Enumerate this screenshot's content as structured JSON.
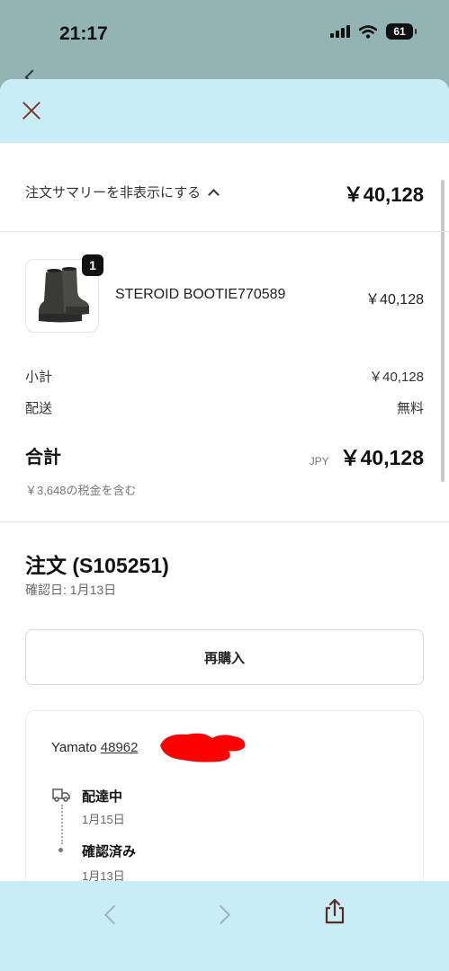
{
  "status_bar": {
    "time": "21:17",
    "battery": "61"
  },
  "sheet": {
    "summary": {
      "toggle_label": "注文サマリーを非表示にする",
      "total": "￥40,128"
    },
    "line_item": {
      "quantity": "1",
      "name": "STEROID BOOTIE770589",
      "price": "￥40,128"
    },
    "costs": {
      "subtotal_label": "小計",
      "subtotal_value": "￥40,128",
      "shipping_label": "配送",
      "shipping_value": "無料",
      "total_label": "合計",
      "currency": "JPY",
      "total_value": "￥40,128",
      "tax_note": "￥3,648の税金を含む"
    },
    "order": {
      "title": "注文 (S105251)",
      "confirmed_date": "確認日: 1月13日",
      "reorder_label": "再購入"
    },
    "tracking": {
      "carrier": "Yamato",
      "tracking_number_visible": "48962",
      "steps": [
        {
          "title": "配達中",
          "date": "1月15日"
        },
        {
          "title": "確認済み",
          "date": "1月13日"
        }
      ]
    }
  },
  "colors": {
    "header_bg": "#c8edf7",
    "close_icon": "#7b3a2d",
    "redaction": "#ff0000"
  },
  "icons": [
    "close-icon",
    "chevron-up-icon",
    "delivery-truck-icon",
    "back-icon",
    "forward-icon",
    "share-icon"
  ]
}
